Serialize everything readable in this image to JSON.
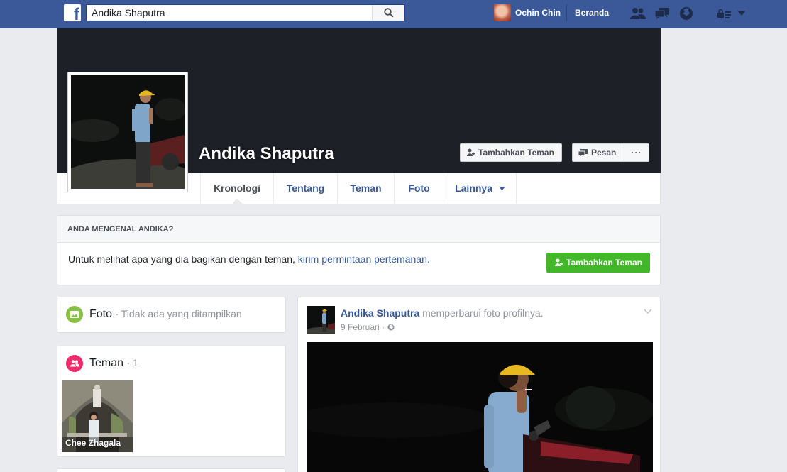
{
  "topbar": {
    "logo": "f",
    "search_value": "Andika Shaputra",
    "user_name": "Ochin Chin",
    "home_label": "Beranda",
    "icons": [
      "friend-requests-icon",
      "messages-icon",
      "notifications-globe-icon",
      "privacy-lock-icon",
      "account-caret-icon"
    ]
  },
  "profile": {
    "name": "Andika Shaputra",
    "add_friend_label": "Tambahkan Teman",
    "message_label": "Pesan",
    "more_label": "···"
  },
  "tabs": [
    {
      "label": "Kronologi"
    },
    {
      "label": "Tentang"
    },
    {
      "label": "Teman"
    },
    {
      "label": "Foto"
    },
    {
      "label": "Lainnya"
    }
  ],
  "know_box": {
    "heading": "ANDA MENGENAL ANDIKA?",
    "text": "Untuk melihat apa yang dia bagikan dengan teman,",
    "link": "kirim permintaan pertemanan.",
    "button": "Tambahkan Teman"
  },
  "photos_card": {
    "title": "Foto",
    "sub": "· Tidak ada yang ditampilkan"
  },
  "friends_card": {
    "title": "Teman",
    "count": "· 1",
    "friends": [
      {
        "name": "Chee Zhagala"
      }
    ]
  },
  "post": {
    "author": "Andika Shaputra",
    "action": "memperbarui foto profilnya.",
    "date": "9 Februari ·"
  },
  "colors": {
    "brand": "#3b5998",
    "link": "#365899",
    "green": "#42b72a",
    "cover": "#1d2027",
    "page_bg": "#e9ebee"
  }
}
